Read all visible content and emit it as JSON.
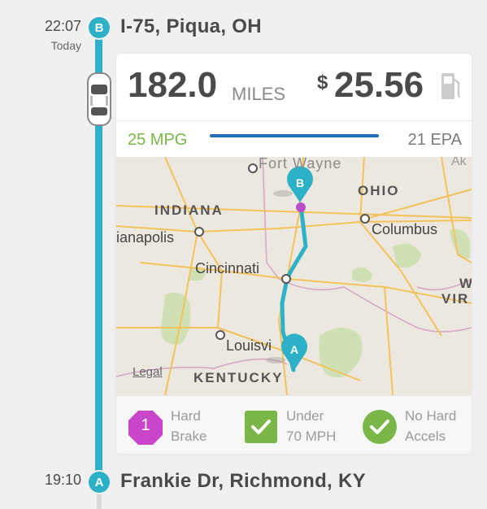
{
  "trip": {
    "end": {
      "time": "22:07",
      "day": "Today",
      "marker": "B",
      "location": "I-75, Piqua, OH"
    },
    "start": {
      "time": "19:10",
      "marker": "A",
      "location": "Frankie Dr, Richmond, KY"
    }
  },
  "summary": {
    "distance": "182.0",
    "distance_unit": "MILES",
    "currency": "$",
    "cost": "25.56",
    "icon": "gas-pump-icon"
  },
  "efficiency": {
    "mpg": "25 MPG",
    "epa": "21 EPA"
  },
  "map": {
    "labels": {
      "fort_wayne": "Fort Wayne",
      "ohio": "OHIO",
      "indiana": "INDIANA",
      "indianapolis": "ianapolis",
      "columbus": "Columbus",
      "cincinnati": "Cincinnati",
      "louisville": "Louisvi",
      "kentucky": "KENTUCKY",
      "wvir": "W",
      "wvir2": "VIR",
      "ak": "Ak",
      "legal": "Legal"
    },
    "route_markers": [
      "A",
      "B"
    ]
  },
  "stats": [
    {
      "icon": "hard-brake-octagon-icon",
      "value": "1",
      "line1": "Hard",
      "line2": "Brake",
      "color": "#c945c9"
    },
    {
      "icon": "checkbox-check-icon",
      "line1": "Under",
      "line2": "70 MPH",
      "color": "#7ab648"
    },
    {
      "icon": "circle-check-icon",
      "line1": "No Hard",
      "line2": "Accels",
      "color": "#7ab648"
    }
  ],
  "colors": {
    "accent": "#2cb1c9",
    "green": "#7ab648",
    "brake": "#c945c9",
    "bar": "#1f6fb8"
  }
}
